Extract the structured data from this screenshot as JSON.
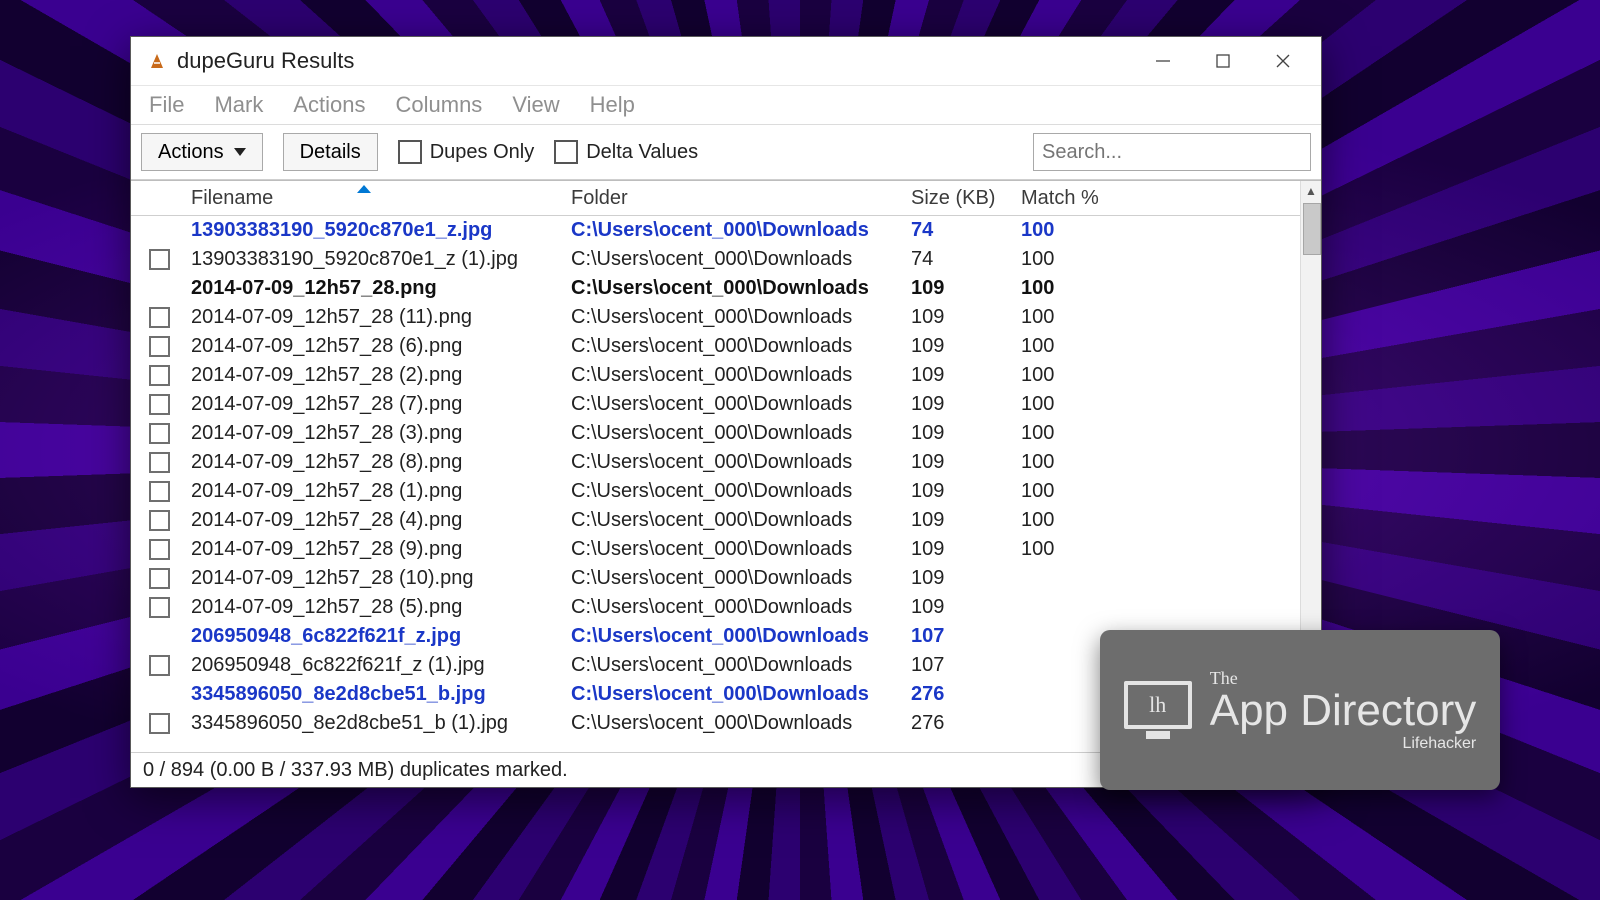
{
  "window": {
    "title": "dupeGuru Results"
  },
  "menubar": [
    "File",
    "Mark",
    "Actions",
    "Columns",
    "View",
    "Help"
  ],
  "toolbar": {
    "actions_label": "Actions",
    "details_label": "Details",
    "dupes_only_label": "Dupes Only",
    "delta_values_label": "Delta Values",
    "search_placeholder": "Search..."
  },
  "columns": {
    "filename": "Filename",
    "folder": "Folder",
    "size": "Size (KB)",
    "match": "Match %"
  },
  "rows": [
    {
      "ref": true,
      "chk": false,
      "filename": "13903383190_5920c870e1_z.jpg",
      "folder": "C:\\Users\\ocent_000\\Downloads",
      "size": "74",
      "match": "100"
    },
    {
      "ref": false,
      "chk": true,
      "filename": "13903383190_5920c870e1_z (1).jpg",
      "folder": "C:\\Users\\ocent_000\\Downloads",
      "size": "74",
      "match": "100"
    },
    {
      "ref": true,
      "bold": true,
      "chk": false,
      "filename": "2014-07-09_12h57_28.png",
      "folder": "C:\\Users\\ocent_000\\Downloads",
      "size": "109",
      "match": "100"
    },
    {
      "ref": false,
      "chk": true,
      "filename": "2014-07-09_12h57_28 (11).png",
      "folder": "C:\\Users\\ocent_000\\Downloads",
      "size": "109",
      "match": "100"
    },
    {
      "ref": false,
      "chk": true,
      "filename": "2014-07-09_12h57_28 (6).png",
      "folder": "C:\\Users\\ocent_000\\Downloads",
      "size": "109",
      "match": "100"
    },
    {
      "ref": false,
      "chk": true,
      "filename": "2014-07-09_12h57_28 (2).png",
      "folder": "C:\\Users\\ocent_000\\Downloads",
      "size": "109",
      "match": "100"
    },
    {
      "ref": false,
      "chk": true,
      "filename": "2014-07-09_12h57_28 (7).png",
      "folder": "C:\\Users\\ocent_000\\Downloads",
      "size": "109",
      "match": "100"
    },
    {
      "ref": false,
      "chk": true,
      "filename": "2014-07-09_12h57_28 (3).png",
      "folder": "C:\\Users\\ocent_000\\Downloads",
      "size": "109",
      "match": "100"
    },
    {
      "ref": false,
      "chk": true,
      "filename": "2014-07-09_12h57_28 (8).png",
      "folder": "C:\\Users\\ocent_000\\Downloads",
      "size": "109",
      "match": "100"
    },
    {
      "ref": false,
      "chk": true,
      "filename": "2014-07-09_12h57_28 (1).png",
      "folder": "C:\\Users\\ocent_000\\Downloads",
      "size": "109",
      "match": "100"
    },
    {
      "ref": false,
      "chk": true,
      "filename": "2014-07-09_12h57_28 (4).png",
      "folder": "C:\\Users\\ocent_000\\Downloads",
      "size": "109",
      "match": "100"
    },
    {
      "ref": false,
      "chk": true,
      "filename": "2014-07-09_12h57_28 (9).png",
      "folder": "C:\\Users\\ocent_000\\Downloads",
      "size": "109",
      "match": "100"
    },
    {
      "ref": false,
      "chk": true,
      "filename": "2014-07-09_12h57_28 (10).png",
      "folder": "C:\\Users\\ocent_000\\Downloads",
      "size": "109",
      "match": ""
    },
    {
      "ref": false,
      "chk": true,
      "filename": "2014-07-09_12h57_28 (5).png",
      "folder": "C:\\Users\\ocent_000\\Downloads",
      "size": "109",
      "match": ""
    },
    {
      "ref": true,
      "chk": false,
      "filename": "206950948_6c822f621f_z.jpg",
      "folder": "C:\\Users\\ocent_000\\Downloads",
      "size": "107",
      "match": ""
    },
    {
      "ref": false,
      "chk": true,
      "filename": "206950948_6c822f621f_z (1).jpg",
      "folder": "C:\\Users\\ocent_000\\Downloads",
      "size": "107",
      "match": ""
    },
    {
      "ref": true,
      "chk": false,
      "filename": "3345896050_8e2d8cbe51_b.jpg",
      "folder": "C:\\Users\\ocent_000\\Downloads",
      "size": "276",
      "match": ""
    },
    {
      "ref": false,
      "chk": true,
      "filename": "3345896050_8e2d8cbe51_b (1).jpg",
      "folder": "C:\\Users\\ocent_000\\Downloads",
      "size": "276",
      "match": ""
    }
  ],
  "status": "0 / 894 (0.00 B / 337.93 MB) duplicates marked.",
  "badge": {
    "the": "The",
    "main": "App Directory",
    "sub": "Lifehacker",
    "logo_letters": "lh"
  }
}
